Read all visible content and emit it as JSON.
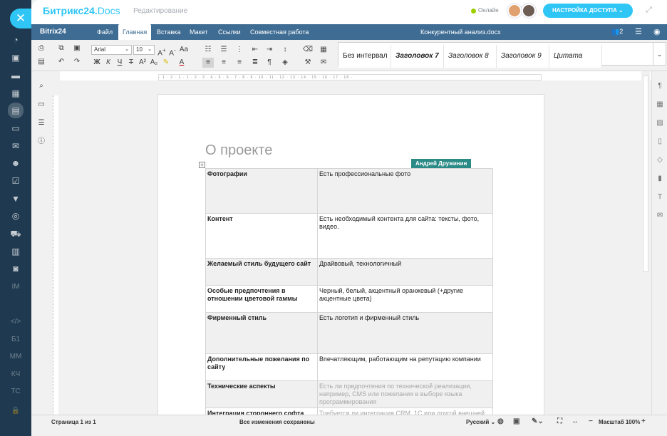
{
  "header": {
    "logo_main": "Битрикс24.",
    "logo_docs": "Docs",
    "mode": "Редактирование",
    "status": "Онлайн",
    "access_button": "НАСТРОЙКА ДОСТУПА"
  },
  "left_nav": {
    "text_items": [
      "IM",
      "</>",
      "Б1",
      "ММ",
      "КЧ",
      "ТС"
    ]
  },
  "menubar": {
    "brand": "Bitrix24",
    "items": [
      "Файл",
      "Главная",
      "Вставка",
      "Макет",
      "Ссылки",
      "Совместная работа"
    ],
    "active": "Главная",
    "document_name": "Конкурентный анализ.docx",
    "users_count": "2"
  },
  "toolbar": {
    "font_family": "Arial",
    "font_size": "10",
    "styles": [
      "Без интервал",
      "Заголовок 7",
      "Заголовок 8",
      "Заголовок 9",
      "Цитата"
    ]
  },
  "document": {
    "heading": "О проекте",
    "collaborator": "Андрей Дружинин",
    "rows": [
      {
        "key": "Фотографии",
        "value": "Есть профессиональные фото"
      },
      {
        "key": "Контент",
        "value": "Есть необходимый контента для сайта: тексты, фото, видео."
      },
      {
        "key": "Желаемый стиль будущего сайт",
        "value": "Драйвовый, технологичный"
      },
      {
        "key": "Особые предпочтения в отношении цветовой гаммы",
        "value": "Черный, белый, акцентный оранжевый (+другие акцентные цвета)"
      },
      {
        "key": "Фирменный стиль",
        "value": "Есть логотип и фирменный стиль"
      },
      {
        "key": "Дополнительные пожелания по сайту",
        "value": "Впечатляющим, работающим на репутацию компании"
      },
      {
        "key": "Технические аспекты",
        "value": "Есть ли предпочтения по технической реализации, например, CMS или пожелания в выборе языка программирования"
      },
      {
        "key": "Интеграция стороннего софта",
        "value": "Требуется ли интеграция CRM, 1С или другой внешней"
      }
    ]
  },
  "statusbar": {
    "page_info": "Страница 1 из 1",
    "saved": "Все изменения сохранены",
    "language": "Русский",
    "zoom": "Масштаб 100%"
  }
}
